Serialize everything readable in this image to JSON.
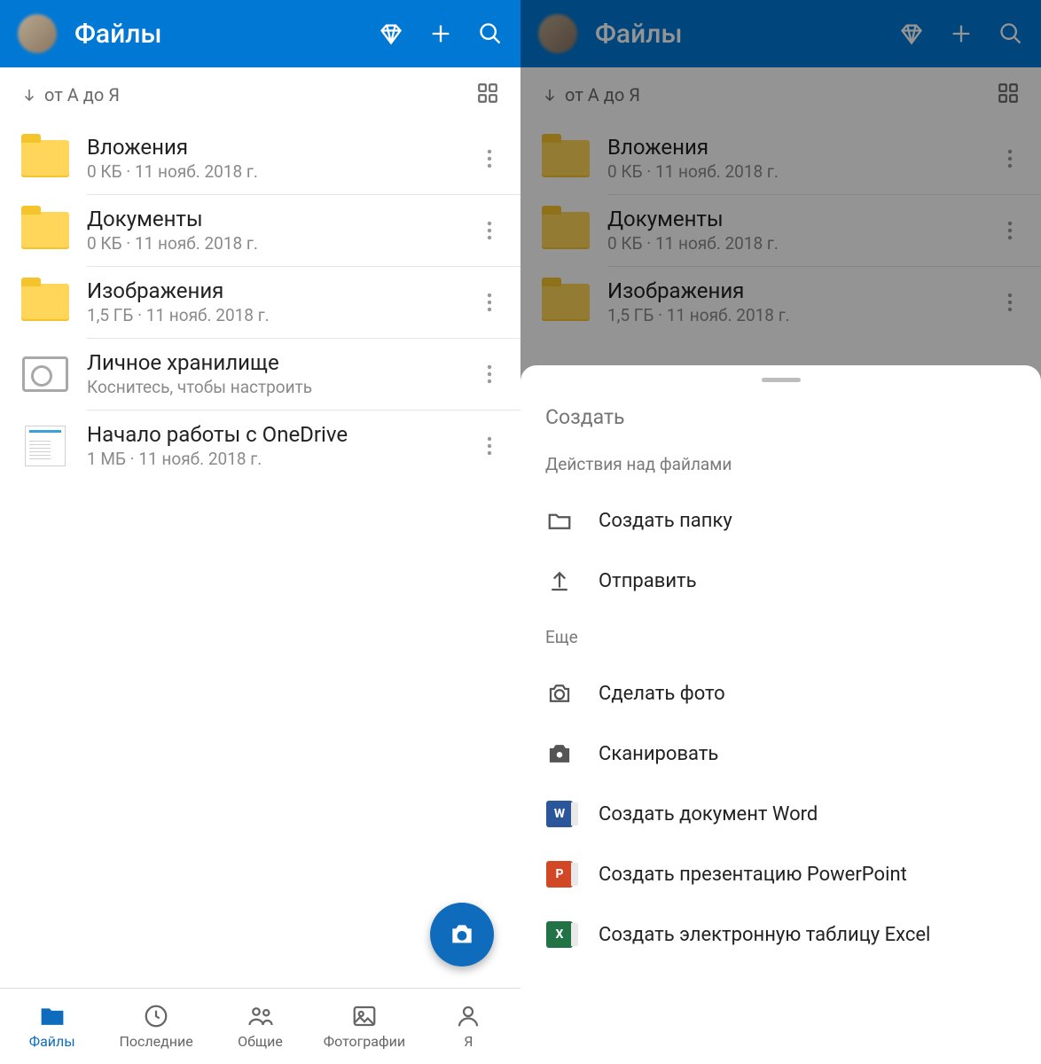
{
  "header": {
    "title": "Файлы"
  },
  "sort": {
    "label": "от А до Я"
  },
  "files": [
    {
      "name": "Вложения",
      "meta": "0 КБ · 11 нояб. 2018 г.",
      "type": "folder"
    },
    {
      "name": "Документы",
      "meta": "0 КБ · 11 нояб. 2018 г.",
      "type": "folder"
    },
    {
      "name": "Изображения",
      "meta": "1,5 ГБ · 11 нояб. 2018 г.",
      "type": "folder"
    },
    {
      "name": "Личное хранилище",
      "meta": "Коснитесь, чтобы настроить",
      "type": "vault"
    },
    {
      "name": "Начало работы с OneDrive",
      "meta": "1 МБ · 11 нояб. 2018 г.",
      "type": "doc"
    }
  ],
  "nav": {
    "files": "Файлы",
    "recent": "Последние",
    "shared": "Общие",
    "photos": "Фотографии",
    "me": "Я"
  },
  "sheet": {
    "title": "Создать",
    "section_files": "Действия над файлами",
    "section_more": "Еще",
    "create_folder": "Создать папку",
    "upload": "Отправить",
    "take_photo": "Сделать фото",
    "scan": "Сканировать",
    "word": "Создать документ Word",
    "ppt": "Создать презентацию PowerPoint",
    "xls": "Создать электронную таблицу Excel"
  }
}
